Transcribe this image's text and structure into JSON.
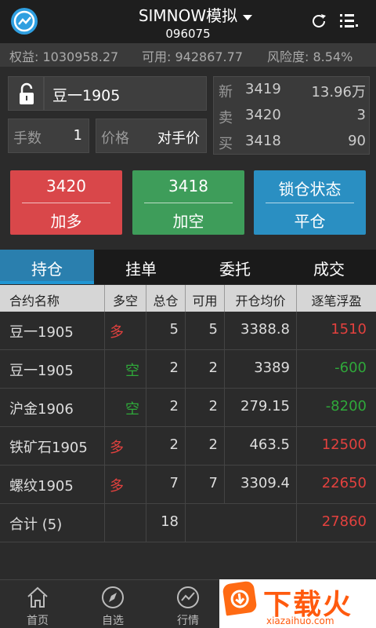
{
  "header": {
    "title": "SIMNOW模拟",
    "account": "096075",
    "icons": {
      "logo": "trend-logo-icon",
      "refresh": "refresh-icon",
      "menu": "menu-list-icon"
    }
  },
  "infobar": {
    "equity": "权益: 1030958.27",
    "available": "可用: 942867.77",
    "risk": "风险度: 8.54%"
  },
  "order": {
    "contract": "豆一1905",
    "qty_label": "手数",
    "qty_value": "1",
    "price_label": "价格",
    "price_value": "对手价"
  },
  "quote": {
    "rows": [
      {
        "k": "新",
        "p": "3419",
        "v": "13.96万"
      },
      {
        "k": "卖",
        "p": "3420",
        "v": "3"
      },
      {
        "k": "买",
        "p": "3418",
        "v": "90"
      }
    ]
  },
  "actions": [
    {
      "top": "3420",
      "bottom": "加多",
      "color": "#d9474a"
    },
    {
      "top": "3418",
      "bottom": "加空",
      "color": "#3e9d5a"
    },
    {
      "top": "锁仓状态",
      "bottom": "平仓",
      "color": "#2a8fc2"
    }
  ],
  "tabs": [
    "持仓",
    "挂单",
    "委托",
    "成交"
  ],
  "table": {
    "headers": [
      "合约名称",
      "多空",
      "总仓",
      "可用",
      "开仓均价",
      "逐笔浮盈"
    ],
    "rows": [
      {
        "name": "豆一1905",
        "side": "多",
        "side_color": "red",
        "total": "5",
        "avail": "5",
        "avg": "3388.8",
        "pnl": "1510",
        "pnl_color": "red"
      },
      {
        "name": "豆一1905",
        "side": "空",
        "side_color": "green",
        "total": "2",
        "avail": "2",
        "avg": "3389",
        "pnl": "-600",
        "pnl_color": "green"
      },
      {
        "name": "沪金1906",
        "side": "空",
        "side_color": "green",
        "total": "2",
        "avail": "2",
        "avg": "279.15",
        "pnl": "-8200",
        "pnl_color": "green"
      },
      {
        "name": "铁矿石1905",
        "side": "多",
        "side_color": "red",
        "total": "2",
        "avail": "2",
        "avg": "463.5",
        "pnl": "12500",
        "pnl_color": "red"
      },
      {
        "name": "螺纹1905",
        "side": "多",
        "side_color": "red",
        "total": "7",
        "avail": "7",
        "avg": "3309.4",
        "pnl": "22650",
        "pnl_color": "red"
      }
    ],
    "summary": {
      "name": "合计 (5)",
      "total": "18",
      "pnl": "27860"
    }
  },
  "nav": [
    {
      "label": "首页",
      "icon": "home-icon"
    },
    {
      "label": "自选",
      "icon": "compass-icon"
    },
    {
      "label": "行情",
      "icon": "chart-icon"
    }
  ],
  "watermark": {
    "text": "下载火",
    "url": "xiazaihuo.com"
  }
}
